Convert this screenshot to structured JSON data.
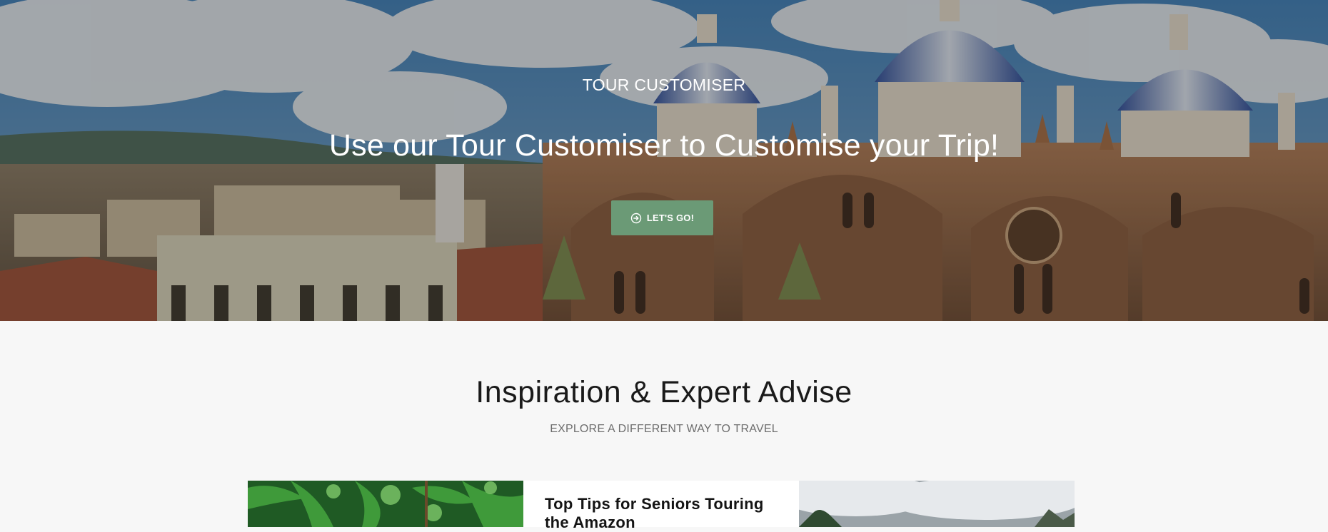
{
  "hero": {
    "eyebrow": "TOUR CUSTOMISER",
    "title": "Use our Tour Customiser to Customise your Trip!",
    "button_label": "LET'S GO!",
    "button_icon": "arrow-circle-right-icon",
    "button_color": "#6b9a76"
  },
  "inspiration": {
    "title": "Inspiration & Expert Advise",
    "subtitle": "EXPLORE A DIFFERENT WAY TO TRAVEL",
    "cards": [
      {
        "title": "Top Tips for Seniors Touring the Amazon"
      }
    ]
  }
}
